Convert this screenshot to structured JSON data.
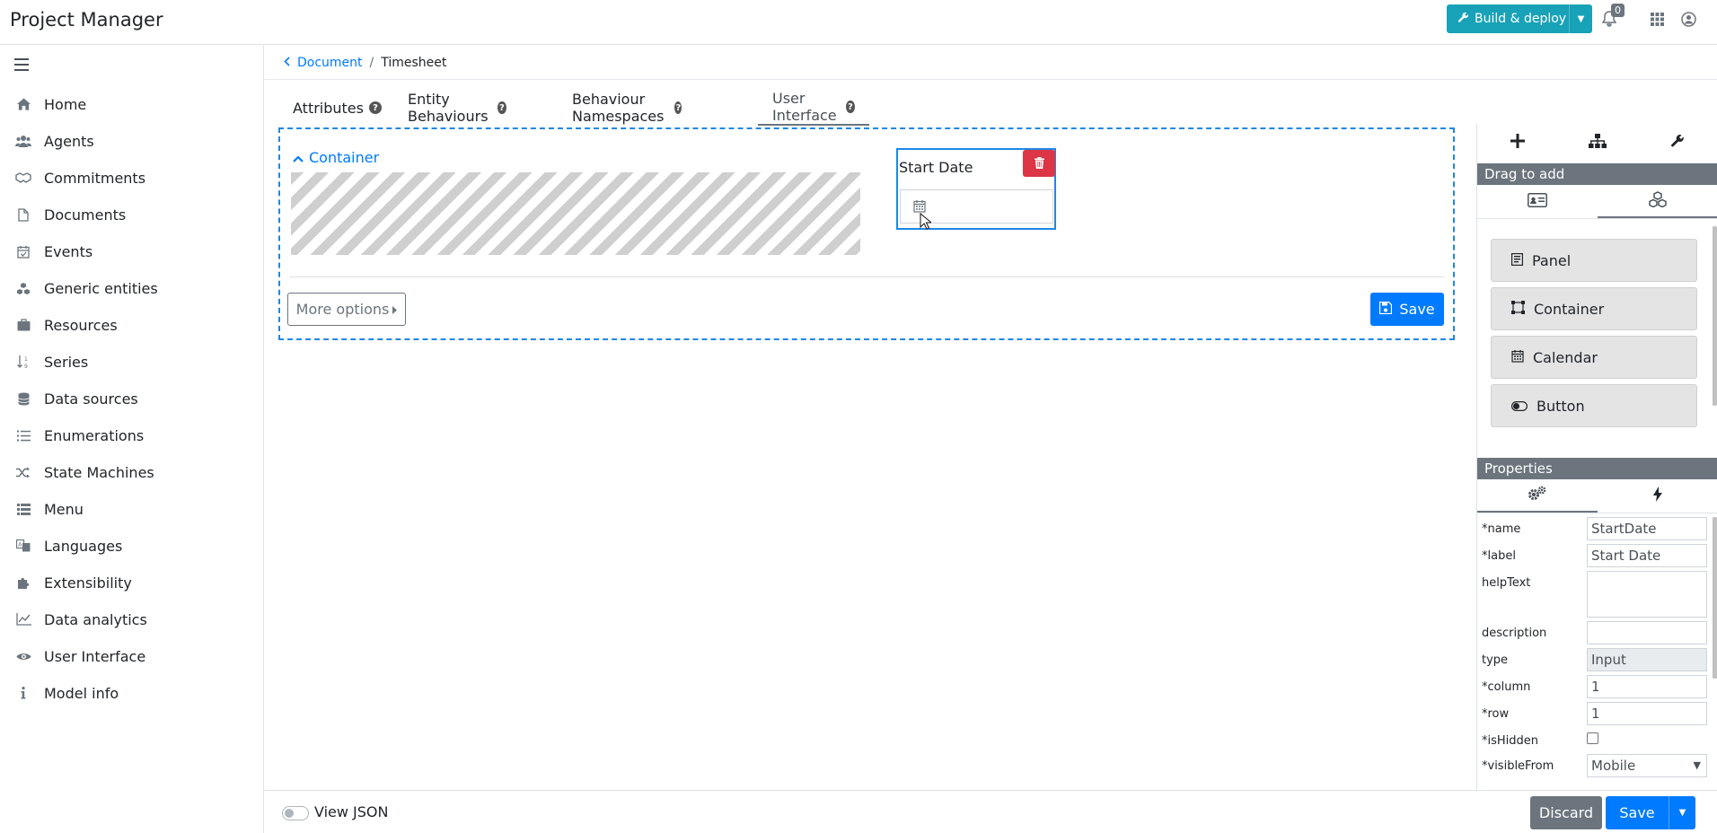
{
  "app": {
    "title": "Project Manager"
  },
  "topbar": {
    "build_label": "Build & deploy",
    "notif_count": "0"
  },
  "sidebar": {
    "items": [
      {
        "label": "Home",
        "icon": "home-icon"
      },
      {
        "label": "Agents",
        "icon": "users-icon"
      },
      {
        "label": "Commitments",
        "icon": "handshake-icon"
      },
      {
        "label": "Documents",
        "icon": "file-icon"
      },
      {
        "label": "Events",
        "icon": "calendar-check-icon"
      },
      {
        "label": "Generic entities",
        "icon": "cubes-icon"
      },
      {
        "label": "Resources",
        "icon": "briefcase-icon"
      },
      {
        "label": "Series",
        "icon": "sort-numeric-icon"
      },
      {
        "label": "Data sources",
        "icon": "database-icon"
      },
      {
        "label": "Enumerations",
        "icon": "list-icon"
      },
      {
        "label": "State Machines",
        "icon": "random-icon"
      },
      {
        "label": "Menu",
        "icon": "list-alt-icon"
      },
      {
        "label": "Languages",
        "icon": "language-icon"
      },
      {
        "label": "Extensibility",
        "icon": "puzzle-icon"
      },
      {
        "label": "Data analytics",
        "icon": "chart-line-icon"
      },
      {
        "label": "User Interface",
        "icon": "eye-icon"
      },
      {
        "label": "Model info",
        "icon": "info-icon"
      }
    ]
  },
  "breadcrumb": {
    "parent": "Document",
    "separator": "/",
    "current": "Timesheet"
  },
  "tabs": [
    {
      "label": "Attributes"
    },
    {
      "label": "Entity Behaviours"
    },
    {
      "label": "Behaviour Namespaces"
    },
    {
      "label": "User Interface"
    }
  ],
  "designer": {
    "container_label": "Container",
    "field_label": "Start Date",
    "more_options": "More options",
    "save": "Save"
  },
  "right_panel": {
    "drag_to_add": "Drag to add",
    "palette": [
      {
        "label": "Panel",
        "icon": "panel-icon"
      },
      {
        "label": "Container",
        "icon": "container-icon"
      },
      {
        "label": "Calendar",
        "icon": "calendar-icon"
      },
      {
        "label": "Button",
        "icon": "toggle-icon"
      }
    ],
    "properties_title": "Properties",
    "properties": {
      "name": {
        "label": "*name",
        "value": "StartDate"
      },
      "label": {
        "label": "*label",
        "value": "Start Date"
      },
      "helpText": {
        "label": "helpText",
        "value": ""
      },
      "description": {
        "label": "description",
        "value": ""
      },
      "type": {
        "label": "type",
        "value": "Input"
      },
      "column": {
        "label": "*column",
        "value": "1"
      },
      "row": {
        "label": "*row",
        "value": "1"
      },
      "isHidden": {
        "label": "*isHidden"
      },
      "visibleFrom": {
        "label": "*visibleFrom",
        "value": "Mobile"
      }
    }
  },
  "footer": {
    "view_json": "View JSON",
    "discard": "Discard",
    "save": "Save"
  },
  "colors": {
    "primary": "#007bff",
    "info": "#17a2b8",
    "danger": "#dc3545",
    "secondary": "#6c757d"
  }
}
